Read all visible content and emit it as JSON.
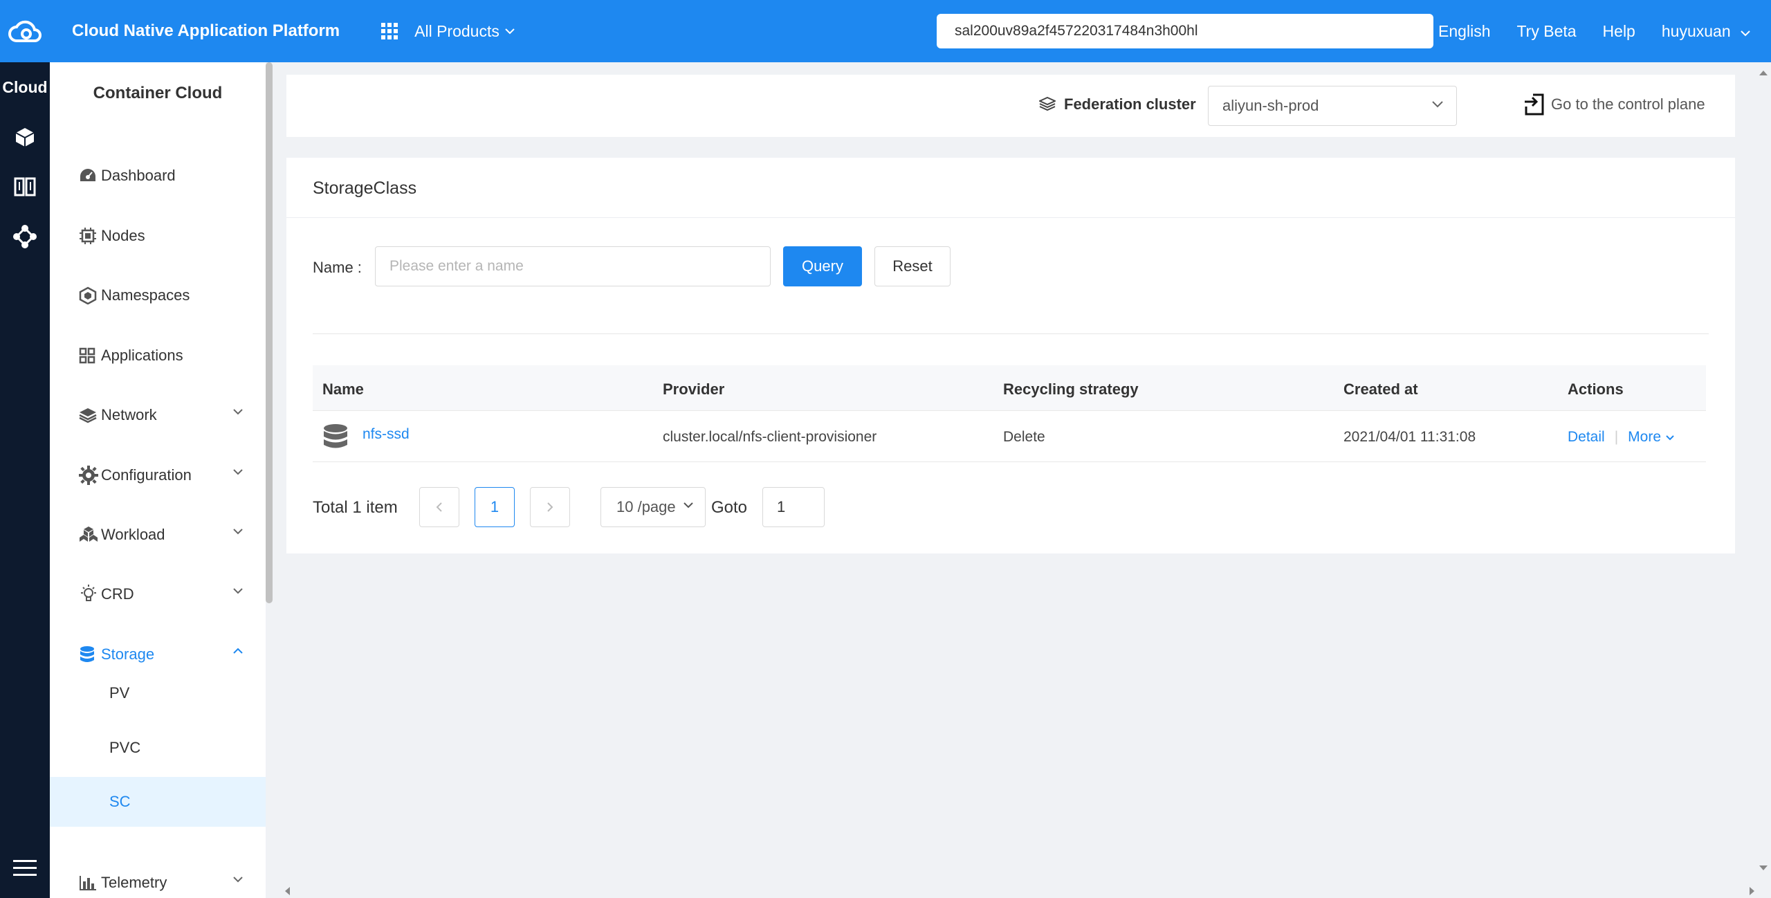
{
  "topbar": {
    "title": "Cloud Native Application Platform",
    "products_label": "All Products",
    "search_value": "sal200uv89a2f457220317484n3h00hl",
    "language": "English",
    "try_beta": "Try Beta",
    "help": "Help",
    "user": "huyuxuan"
  },
  "rail": {
    "title": "Cloud"
  },
  "sidebar": {
    "title": "Container Cloud",
    "items": [
      {
        "label": "Dashboard",
        "icon": "dashboard-icon"
      },
      {
        "label": "Nodes",
        "icon": "chip-icon"
      },
      {
        "label": "Namespaces",
        "icon": "cube-group-icon"
      },
      {
        "label": "Applications",
        "icon": "apps-grid-icon"
      },
      {
        "label": "Network",
        "icon": "layers-icon"
      },
      {
        "label": "Configuration",
        "icon": "gear-icon"
      },
      {
        "label": "Workload",
        "icon": "cubes-icon"
      },
      {
        "label": "CRD",
        "icon": "bulb-icon"
      },
      {
        "label": "Storage",
        "icon": "database-icon"
      },
      {
        "label": "Telemetry",
        "icon": "bar-chart-icon"
      }
    ],
    "storage_children": [
      {
        "label": "PV"
      },
      {
        "label": "PVC"
      },
      {
        "label": "SC"
      }
    ]
  },
  "federation": {
    "label": "Federation cluster",
    "selected": "aliyun-sh-prod",
    "control_plane": "Go to the control plane"
  },
  "storageclass": {
    "title": "StorageClass",
    "filter": {
      "name_label": "Name :",
      "placeholder": "Please enter a name",
      "query": "Query",
      "reset": "Reset"
    },
    "columns": [
      "Name",
      "Provider",
      "Recycling strategy",
      "Created at",
      "Actions"
    ],
    "rows": [
      {
        "name": "nfs-ssd",
        "provider": "cluster.local/nfs-client-provisioner",
        "recycling": "Delete",
        "created": "2021/04/01 11:31:08",
        "detail": "Detail",
        "more": "More"
      }
    ],
    "pager": {
      "total": "Total 1 item",
      "current_page": "1",
      "page_size": "10 /page",
      "goto_label": "Goto",
      "goto_value": "1"
    }
  },
  "colors": {
    "primary": "#1e88f0",
    "rail": "#0d1a2e",
    "background": "#f0f2f5"
  }
}
